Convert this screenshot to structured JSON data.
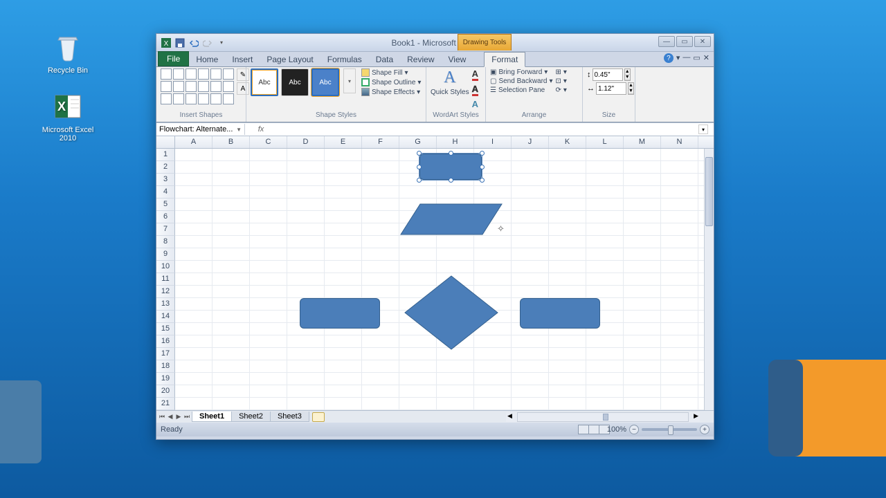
{
  "desktop": {
    "recycle_bin": "Recycle Bin",
    "excel_icon": "Microsoft Excel 2010"
  },
  "window": {
    "title": "Book1 - Microsoft Excel",
    "contextual_tab": "Drawing Tools"
  },
  "tabs": {
    "file": "File",
    "home": "Home",
    "insert": "Insert",
    "page_layout": "Page Layout",
    "formulas": "Formulas",
    "data": "Data",
    "review": "Review",
    "view": "View",
    "format": "Format"
  },
  "ribbon": {
    "insert_shapes": "Insert Shapes",
    "shape_styles": "Shape Styles",
    "wordart_styles": "WordArt Styles",
    "arrange": "Arrange",
    "size": "Size",
    "style_abc": "Abc",
    "shape_fill": "Shape Fill",
    "shape_outline": "Shape Outline",
    "shape_effects": "Shape Effects",
    "quick_styles": "Quick Styles",
    "bring_forward": "Bring Forward",
    "send_backward": "Send Backward",
    "selection_pane": "Selection Pane",
    "height": "0.45\"",
    "width": "1.12\""
  },
  "formula": {
    "name_box": "Flowchart: Alternate...",
    "fx": "fx"
  },
  "columns": [
    "A",
    "B",
    "C",
    "D",
    "E",
    "F",
    "G",
    "H",
    "I",
    "J",
    "K",
    "L",
    "M",
    "N"
  ],
  "rows": [
    "1",
    "2",
    "3",
    "4",
    "5",
    "6",
    "7",
    "8",
    "9",
    "10",
    "11",
    "12",
    "13",
    "14",
    "15",
    "16",
    "17",
    "18",
    "19",
    "20",
    "21"
  ],
  "sheets": {
    "s1": "Sheet1",
    "s2": "Sheet2",
    "s3": "Sheet3"
  },
  "status": {
    "ready": "Ready",
    "zoom": "100%"
  }
}
